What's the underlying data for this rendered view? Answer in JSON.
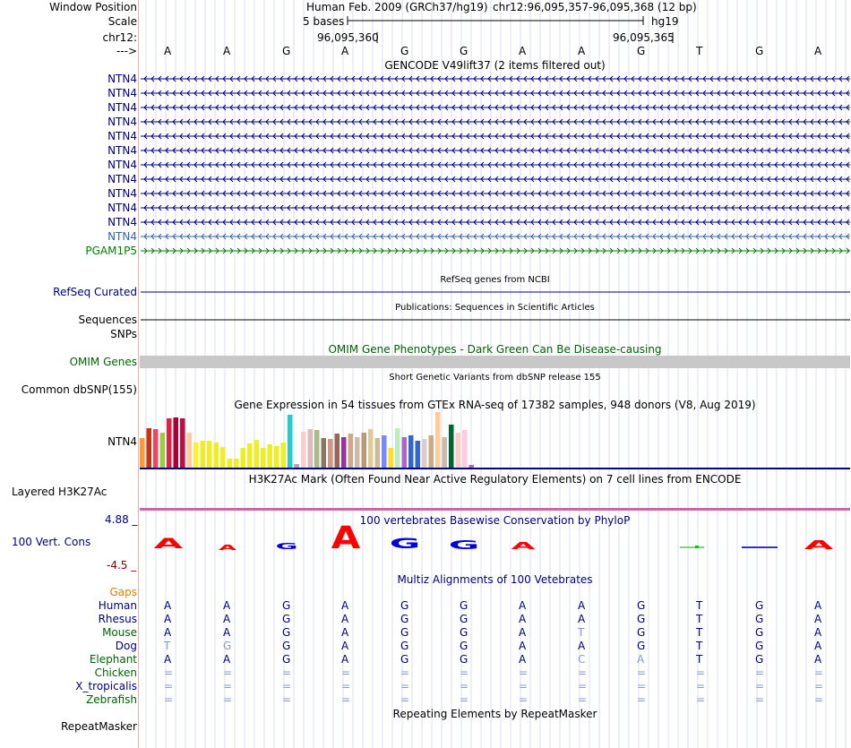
{
  "header": {
    "window_position_label": "Window Position",
    "scale_label": "Scale",
    "chrom_label": "chr12:",
    "strand_label": "--->",
    "assembly_text": "Human Feb. 2009 (GRCh37/hg19)",
    "position_text": "chr12:96,095,357-96,095,368 (12 bp)",
    "scale_bases": "5 bases",
    "scale_db": "hg19",
    "coord_left": "96,095,360",
    "coord_right": "96,095,365"
  },
  "bases": [
    "A",
    "A",
    "G",
    "A",
    "G",
    "G",
    "A",
    "A",
    "G",
    "T",
    "G",
    "A"
  ],
  "gencode": {
    "title": "GENCODE V49lift37 (2 items filtered out)",
    "items": [
      "NTN4",
      "NTN4",
      "NTN4",
      "NTN4",
      "NTN4",
      "NTN4",
      "NTN4",
      "NTN4",
      "NTN4",
      "NTN4",
      "NTN4",
      "NTN4",
      "PGAM1P5"
    ]
  },
  "refseq": {
    "title": "RefSeq genes from NCBI",
    "label": "RefSeq Curated"
  },
  "publications": {
    "title": "Publications: Sequences in Scientific Articles",
    "label": "Sequences"
  },
  "snps_label": "SNPs",
  "omim": {
    "title": "OMIM Gene Phenotypes - Dark Green Can Be Disease-causing",
    "label": "OMIM Genes"
  },
  "dbsnp": {
    "title": "Short Genetic Variants from dbSNP release 155",
    "label": "Common dbSNP(155)"
  },
  "gtex": {
    "title": "Gene Expression in 54 tissues from GTEx RNA-seq of 17382 samples, 948 donors (V8, Aug 2019)",
    "label": "NTN4"
  },
  "h3k27ac": {
    "title": "H3K27Ac Mark (Often Found Near Active Regulatory Elements) on 7 cell lines from ENCODE",
    "label": "Layered H3K27Ac"
  },
  "phylop": {
    "title": "100 vertebrates Basewise Conservation by PhyloP",
    "label": "100 Vert. Cons",
    "max_label": "4.88 _",
    "min_label": "-4.5 _"
  },
  "multiz": {
    "title": "Multiz Alignments of 100 Vetebrates",
    "gaps_label": "Gaps",
    "species": [
      {
        "name": "Human",
        "bases": [
          "A",
          "A",
          "G",
          "A",
          "G",
          "G",
          "A",
          "A",
          "G",
          "T",
          "G",
          "A"
        ]
      },
      {
        "name": "Rhesus",
        "bases": [
          "A",
          "A",
          "G",
          "A",
          "G",
          "G",
          "A",
          "A",
          "G",
          "T",
          "G",
          "A"
        ]
      },
      {
        "name": "Mouse",
        "bases": [
          "A",
          "A",
          "G",
          "A",
          "G",
          "G",
          "A",
          "T",
          "G",
          "T",
          "G",
          "A"
        ]
      },
      {
        "name": "Dog",
        "bases": [
          "T",
          "G",
          "G",
          "A",
          "G",
          "G",
          "A",
          "A",
          "G",
          "T",
          "G",
          "A"
        ]
      },
      {
        "name": "Elephant",
        "bases": [
          "A",
          "A",
          "G",
          "A",
          "G",
          "G",
          "A",
          "C",
          "A",
          "T",
          "G",
          "A"
        ]
      },
      {
        "name": "Chicken",
        "bases": [
          "=",
          "=",
          "=",
          "=",
          "=",
          "=",
          "=",
          "=",
          "=",
          "=",
          "=",
          "="
        ]
      },
      {
        "name": "X_tropicalis",
        "bases": [
          "=",
          "=",
          "=",
          "=",
          "=",
          "=",
          "=",
          "=",
          "=",
          "=",
          "=",
          "="
        ]
      },
      {
        "name": "Zebrafish",
        "bases": [
          "=",
          "=",
          "=",
          "=",
          "=",
          "=",
          "=",
          "=",
          "=",
          "=",
          "=",
          "="
        ]
      }
    ]
  },
  "repeatmasker": {
    "title": "Repeating Elements by RepeatMasker",
    "label": "RepeatMasker"
  },
  "colors": {
    "navy": "#000080",
    "dark_green": "#006400",
    "light_blue_ntn4": "#3366aa",
    "pgam_green": "#008000",
    "omim_gray": "#c8c8c8",
    "gaps_orange": "#e08000",
    "phylop_max": "#000080",
    "phylop_min": "#800000"
  }
}
